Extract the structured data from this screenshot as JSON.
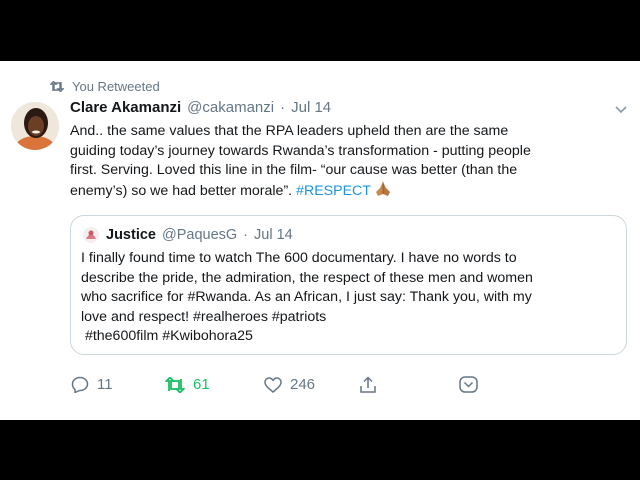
{
  "retweet_banner": {
    "label": "You Retweeted",
    "icon": "retweet-icon"
  },
  "tweet": {
    "author_name": "Clare Akamanzi",
    "handle": "@cakamanzi",
    "separator": "·",
    "date": "Jul 14",
    "text_lines": [
      "And.. the same values that the RPA leaders upheld then are the same",
      "guiding today’s journey towards Rwanda’s transformation  - putting people",
      "first. Serving.   Loved this line in the film- “our cause was better (than the",
      "enemy’s) so we had better morale”."
    ],
    "hashtag": "#RESPECT",
    "emoji_icon": "folded-hands-icon"
  },
  "quoted_tweet": {
    "author_name": "Justice",
    "handle": "@PaquesG",
    "separator": "·",
    "date": "Jul 14",
    "text_lines": [
      "I finally found time to watch The 600 documentary. I have no words to",
      "describe the pride, the admiration, the respect of these men and women",
      "who sacrifice for #Rwanda. As an African, I just say: Thank you, with my",
      "love and respect! #realheroes #patriots",
      " #the600film #Kwibohora25"
    ]
  },
  "actions": {
    "reply_count": "11",
    "retweet_count": "61",
    "like_count": "246"
  },
  "colors": {
    "link": "#1b95e0",
    "muted": "#657786",
    "retweet_active": "#17bf63",
    "border": "#ccd6dd"
  }
}
